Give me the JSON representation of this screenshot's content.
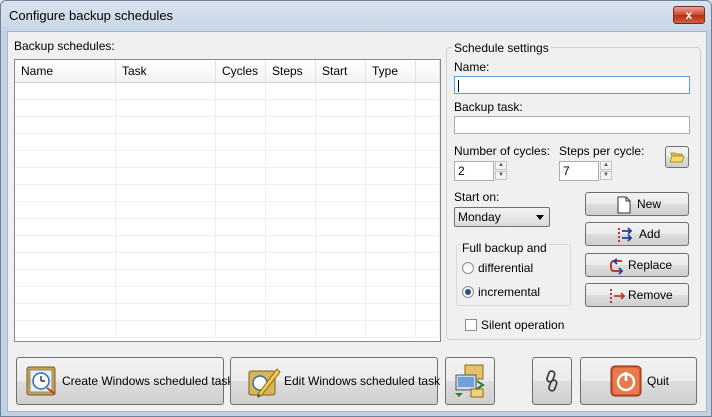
{
  "window": {
    "title": "Configure backup schedules",
    "close_glyph": "x"
  },
  "schedules": {
    "label": "Backup schedules:",
    "columns": [
      "Name",
      "Task",
      "Cycles",
      "Steps",
      "Start",
      "Type"
    ]
  },
  "settings": {
    "legend": "Schedule settings",
    "name_label": "Name:",
    "name_value": "",
    "task_label": "Backup task:",
    "task_value": "",
    "cycles_label": "Number of cycles:",
    "cycles_value": "2",
    "steps_label": "Steps per cycle:",
    "steps_value": "7",
    "start_label": "Start on:",
    "start_value": "Monday",
    "full_backup_label": "Full backup and",
    "radio_differential": "differential",
    "radio_incremental": "incremental",
    "selected_mode": "incremental",
    "silent_label": "Silent operation",
    "silent_checked": false
  },
  "actions": {
    "new": "New",
    "add": "Add",
    "replace": "Replace",
    "remove": "Remove"
  },
  "bottom": {
    "create_task": "Create Windows scheduled task",
    "edit_task": "Edit Windows scheduled task",
    "quit": "Quit"
  },
  "icons": {
    "browse": "folder-open-icon",
    "new": "document-icon",
    "add": "add-arrows-icon",
    "replace": "replace-arrows-icon",
    "remove": "remove-arrows-icon",
    "create": "clock-task-icon",
    "edit": "edit-task-icon",
    "export": "computer-folder-icon",
    "link": "link-icon",
    "quit": "power-icon"
  },
  "colors": {
    "accent": "#569de5",
    "quit_red": "#d9582f",
    "title_bar": "#c7d6e6"
  }
}
